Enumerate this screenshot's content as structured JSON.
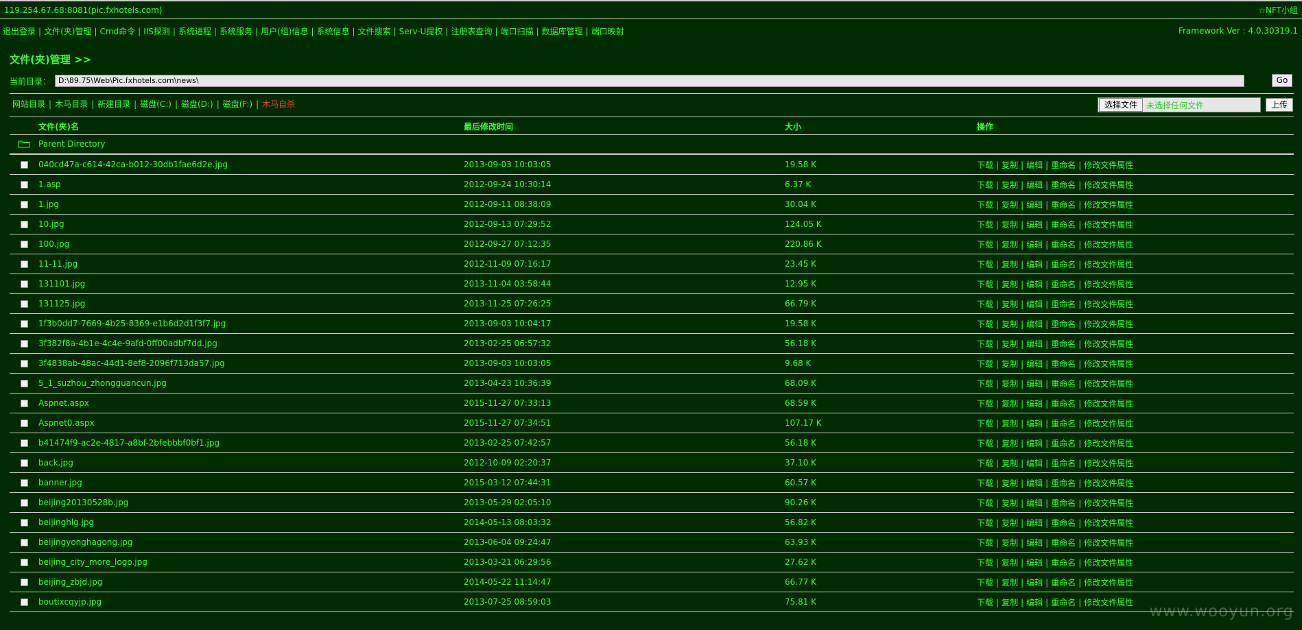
{
  "header": {
    "host": "119.254.67.68:8081(pic.fxhotels.com)",
    "brand": "☆NFT小组"
  },
  "nav": {
    "items": [
      "退出登录",
      "文件(夹)管理",
      "Cmd命令",
      "IIS探测",
      "系统进程",
      "系统服务",
      "用户(组)信息",
      "系统信息",
      "文件搜索",
      "Serv-U提权",
      "注册表查询",
      "端口扫描",
      "数据库管理",
      "端口映射"
    ],
    "framework": "Framework Ver : 4.0.30319.1"
  },
  "page": {
    "title": "文件(夹)管理 >>",
    "current_dir_label": "当前目录：",
    "current_dir": "D:\\89.75\\Web\\Pic.fxhotels.com\\news\\",
    "go_label": "Go"
  },
  "links": {
    "items": [
      "网站目录",
      "木马目录",
      "新建目录",
      "磁盘(C:)",
      "磁盘(D:)",
      "磁盘(F:)"
    ],
    "danger": "木马自杀"
  },
  "upload": {
    "choose_label": "选择文件",
    "no_file_text": "未选择任何文件",
    "upload_label": "上传"
  },
  "table": {
    "headers": {
      "name": "文件(夹)名",
      "time": "最后修改时间",
      "size": "大小",
      "ops": "操作"
    },
    "parent": "Parent Directory",
    "ops": [
      "下载",
      "复制",
      "编辑",
      "重命名",
      "修改文件属性"
    ],
    "rows": [
      {
        "name": "040cd47a-c614-42ca-b012-30db1fae6d2e.jpg",
        "time": "2013-09-03 10:03:05",
        "size": "19.58 K"
      },
      {
        "name": "1.asp",
        "time": "2012-09-24 10:30:14",
        "size": "6.37 K"
      },
      {
        "name": "1.jpg",
        "time": "2012-09-11 08:38:09",
        "size": "30.04 K"
      },
      {
        "name": "10.jpg",
        "time": "2012-09-13 07:29:52",
        "size": "124.05 K"
      },
      {
        "name": "100.jpg",
        "time": "2012-09-27 07:12:35",
        "size": "220.86 K"
      },
      {
        "name": "11-11.jpg",
        "time": "2012-11-09 07:16:17",
        "size": "23.45 K"
      },
      {
        "name": "131101.jpg",
        "time": "2013-11-04 03:58:44",
        "size": "12.95 K"
      },
      {
        "name": "131125.jpg",
        "time": "2013-11-25 07:26:25",
        "size": "66.79 K"
      },
      {
        "name": "1f3b0dd7-7669-4b25-8369-e1b6d2d1f3f7.jpg",
        "time": "2013-09-03 10:04:17",
        "size": "19.58 K"
      },
      {
        "name": "3f382f8a-4b1e-4c4e-9afd-0ff00adbf7dd.jpg",
        "time": "2013-02-25 06:57:32",
        "size": "56.18 K"
      },
      {
        "name": "3f4838ab-48ac-44d1-8ef8-2096f713da57.jpg",
        "time": "2013-09-03 10:03:05",
        "size": "9.68 K"
      },
      {
        "name": "5_1_suzhou_zhongguancun.jpg",
        "time": "2013-04-23 10:36:39",
        "size": "68.09 K"
      },
      {
        "name": "Aspnet.aspx",
        "time": "2015-11-27 07:33:13",
        "size": "68.59 K"
      },
      {
        "name": "Aspnet0.aspx",
        "time": "2015-11-27 07:34:51",
        "size": "107.17 K"
      },
      {
        "name": "b41474f9-ac2e-4817-a8bf-2bfebbbf0bf1.jpg",
        "time": "2013-02-25 07:42:57",
        "size": "56.18 K"
      },
      {
        "name": "back.jpg",
        "time": "2012-10-09 02:20:37",
        "size": "37.10 K"
      },
      {
        "name": "banner.jpg",
        "time": "2015-03-12 07:44:31",
        "size": "60.57 K"
      },
      {
        "name": "beijing20130528b.jpg",
        "time": "2013-05-29 02:05:10",
        "size": "90.26 K"
      },
      {
        "name": "beijinghlg.jpg",
        "time": "2014-05-13 08:03:32",
        "size": "56.82 K"
      },
      {
        "name": "beijingyonghagong.jpg",
        "time": "2013-06-04 09:24:47",
        "size": "63.93 K"
      },
      {
        "name": "beijing_city_more_logo.jpg",
        "time": "2013-03-21 06:29:56",
        "size": "27.62 K"
      },
      {
        "name": "beijing_zbjd.jpg",
        "time": "2014-05-22 11:14:47",
        "size": "66.77 K"
      },
      {
        "name": "boutixcqyjp.jpg",
        "time": "2013-07-25 08:59:03",
        "size": "75.81 K"
      }
    ]
  },
  "watermark": "www.wooyun.org"
}
